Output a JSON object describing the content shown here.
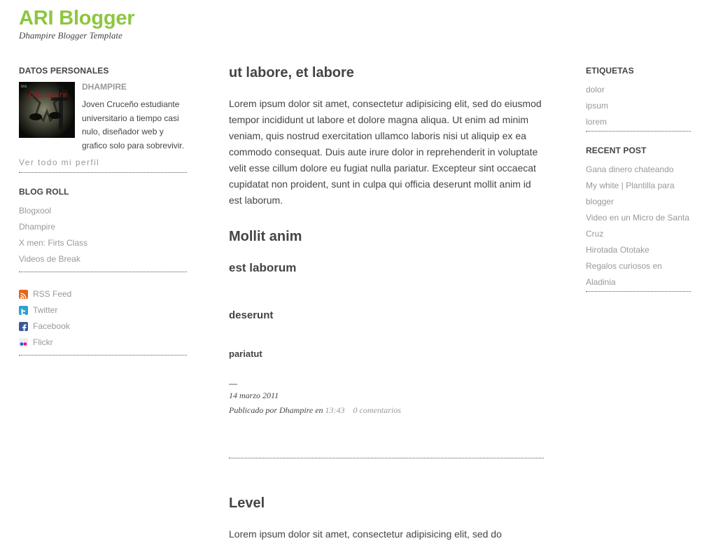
{
  "header": {
    "title": "ARI Blogger",
    "description": "Dhampire Blogger Template",
    "title_color": "#8dc63f"
  },
  "sidebar_left": {
    "profile": {
      "heading": "DATOS PERSONALES",
      "name": "DHAMPIRE",
      "bio": "Joven Cruceño estudiante universitario a tiempo casi nulo, diseñador web y grafico solo para sobrevivir.",
      "image_caption": "Dhampire",
      "more_link": "Ver todo mi perfil"
    },
    "blogroll": {
      "heading": "BLOG ROLL",
      "items": [
        "Blogxool",
        "Dhampire",
        "X men: Firts Class",
        "Videos de Break"
      ]
    },
    "social": {
      "items": [
        {
          "label": "RSS Feed",
          "icon": "rss-icon"
        },
        {
          "label": "Twitter",
          "icon": "twitter-icon"
        },
        {
          "label": "Facebook",
          "icon": "facebook-icon"
        },
        {
          "label": "Flickr",
          "icon": "flickr-icon"
        }
      ]
    }
  },
  "main": {
    "post1": {
      "title": "ut labore, et labore",
      "paragraph": "Lorem ipsum dolor sit amet, consectetur adipisicing elit, sed do eiusmod tempor incididunt ut labore et dolore magna aliqua. Ut enim ad minim veniam, quis nostrud exercitation ullamco laboris nisi ut aliquip ex ea commodo consequat. Duis aute irure dolor in reprehenderit in voluptate velit esse cillum dolore eu fugiat nulla pariatur. Excepteur sint occaecat cupidatat non proident, sunt in culpa qui officia deserunt mollit anim id est laborum.",
      "h2": "Mollit anim",
      "h3": "est laborum",
      "h4": "deserunt",
      "h5": "pariatut",
      "dash": "—",
      "date": "14 marzo 2011",
      "posted_by": "Publicado por Dhampire en",
      "time": "13:43",
      "comments": "0 comentarios"
    },
    "post2": {
      "title": "Level",
      "paragraph": "Lorem ipsum dolor sit amet, consectetur adipisicing elit, sed do"
    }
  },
  "sidebar_right": {
    "labels": {
      "heading": "ETIQUETAS",
      "items": [
        "dolor",
        "ipsum",
        "lorem"
      ]
    },
    "recent": {
      "heading": "RECENT POST",
      "items": [
        "Gana dinero chateando",
        "My white | Plantilla para blogger",
        "Video en un Micro de Santa Cruz",
        "Hirotada Ototake",
        "Regalos curiosos en Aladinia"
      ]
    }
  }
}
